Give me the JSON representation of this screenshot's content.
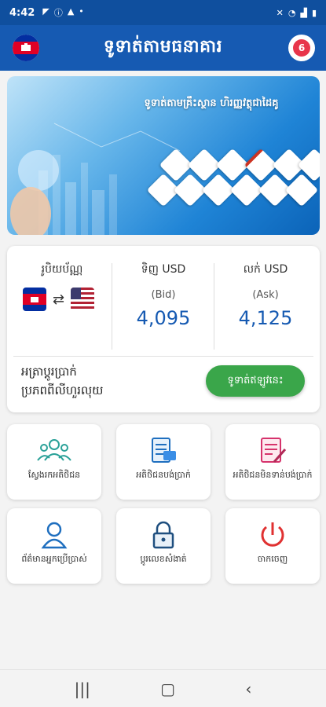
{
  "status": {
    "time": "4:42",
    "left_icons": [
      "telegram-icon",
      "info-icon",
      "warning-icon",
      "dot-icon"
    ],
    "right_icons": [
      "mute-icon",
      "wifi-icon",
      "signal-icon",
      "battery-icon"
    ]
  },
  "appbar": {
    "title": "ទូទាត់តាមធនាគារ",
    "notification_count": "6"
  },
  "banner": {
    "headline": "ទូទាត់តាមគ្រឹះស្ថាន ហិរញ្ញវត្ថុជាដៃគូ"
  },
  "rates": {
    "currency_label": "រូបិយប័ណ្ណ",
    "buy_label": "ទិញ USD",
    "buy_sub": "(Bid)",
    "buy_value": "4,095",
    "sell_label": "លក់ USD",
    "sell_sub": "(Ask)",
    "sell_value": "4,125",
    "footer_line1": "អត្រាប្តូរប្រាក់",
    "footer_line2": "ប្រភពពីលីហួរលុយ",
    "pay_button": "ទូទាត់ឥឡូវនេះ"
  },
  "menu": [
    {
      "label": "ស្វែងរកអតិថិជន",
      "icon": "people-icon"
    },
    {
      "label": "អតិថិជនបង់ប្រាក់",
      "icon": "invoice-icon"
    },
    {
      "label": "អតិថិជនមិនទាន់បង់ប្រាក់",
      "icon": "document-pen-icon"
    },
    {
      "label": "ព័ត៌មានអ្នកប្រើប្រាស់",
      "icon": "user-icon"
    },
    {
      "label": "ប្តូរលេខសំងាត់",
      "icon": "lock-icon"
    },
    {
      "label": "ចាកចេញ",
      "icon": "power-icon"
    }
  ],
  "colors": {
    "primary": "#165ab2",
    "green": "#3aa64a",
    "badge": "#e8354b"
  }
}
